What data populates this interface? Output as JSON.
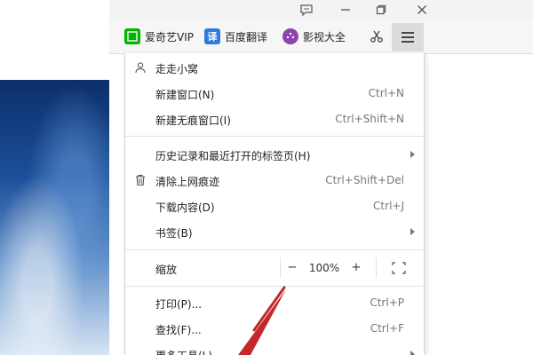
{
  "bookmarks": [
    {
      "label": "爱奇艺VIP",
      "badge": "iQ",
      "color": "#00b400"
    },
    {
      "label": "百度翻译",
      "badge": "译",
      "color": "#2f7bdb"
    },
    {
      "label": "影视大全",
      "badge": "●",
      "color": "#8e44ad"
    }
  ],
  "menu": {
    "user": "走走小窝",
    "items": [
      {
        "label": "新建窗口(N)",
        "shortcut": "Ctrl+N"
      },
      {
        "label": "新建无痕窗口(I)",
        "shortcut": "Ctrl+Shift+N"
      },
      {
        "label": "历史记录和最近打开的标签页(H)",
        "shortcut": ""
      },
      {
        "label": "清除上网痕迹",
        "shortcut": "Ctrl+Shift+Del"
      },
      {
        "label": "下载内容(D)",
        "shortcut": "Ctrl+J"
      },
      {
        "label": "书签(B)",
        "shortcut": ""
      },
      {
        "label": "打印(P)...",
        "shortcut": "Ctrl+P"
      },
      {
        "label": "查找(F)...",
        "shortcut": "Ctrl+F"
      },
      {
        "label": "更多工具(L)",
        "shortcut": ""
      }
    ],
    "zoom": {
      "label": "缩放",
      "minus": "−",
      "value": "100%",
      "plus": "+"
    }
  },
  "colors": {
    "annotation_arrow": "#c0282a",
    "menu_button_active": "#dcdcdc"
  },
  "icons": [
    "feedback-icon",
    "minimize-icon",
    "restore-icon",
    "close-icon",
    "scissors-icon",
    "hamburger-menu-icon",
    "user-icon",
    "trash-icon",
    "fullscreen-icon"
  ]
}
